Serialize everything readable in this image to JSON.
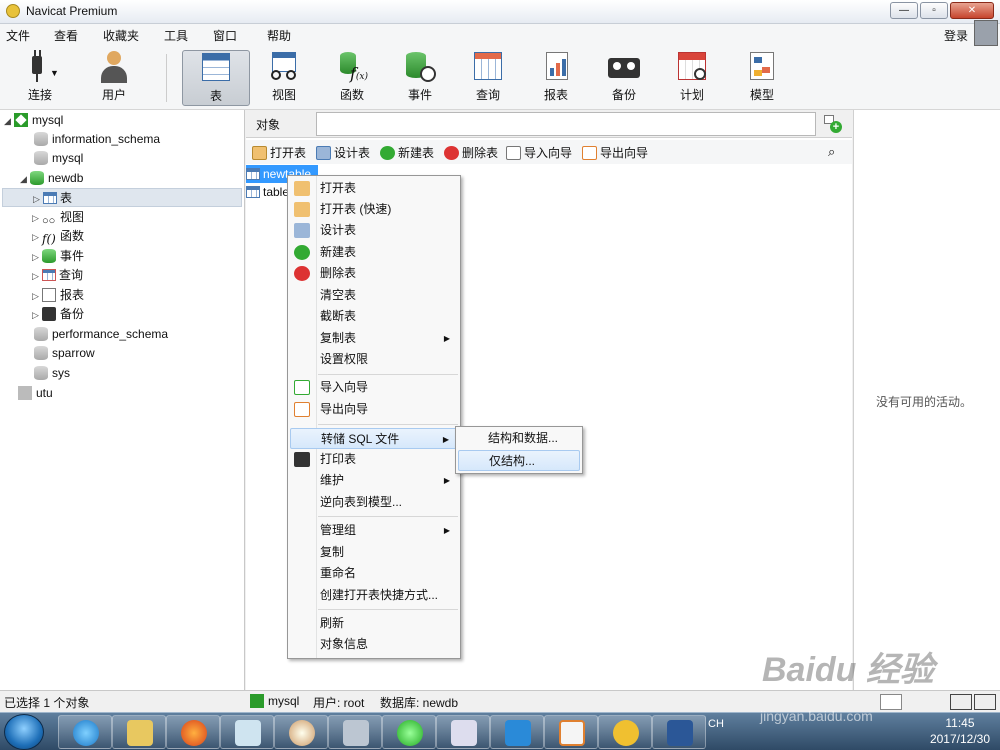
{
  "window": {
    "title": "Navicat Premium"
  },
  "menubar": {
    "items": [
      "文件",
      "查看",
      "收藏夹",
      "工具",
      "窗口",
      "帮助"
    ],
    "login": "登录"
  },
  "toolbar": {
    "items": [
      "连接",
      "用户",
      "表",
      "视图",
      "函数",
      "事件",
      "查询",
      "报表",
      "备份",
      "计划",
      "模型"
    ],
    "active": "表"
  },
  "tree": {
    "nodes": [
      {
        "label": "mysql"
      },
      {
        "label": "information_schema"
      },
      {
        "label": "mysql"
      },
      {
        "label": "newdb"
      },
      {
        "label": "表"
      },
      {
        "label": "视图"
      },
      {
        "label": "函数"
      },
      {
        "label": "事件"
      },
      {
        "label": "查询"
      },
      {
        "label": "报表"
      },
      {
        "label": "备份"
      },
      {
        "label": "performance_schema"
      },
      {
        "label": "sparrow"
      },
      {
        "label": "sys"
      },
      {
        "label": "utu"
      }
    ]
  },
  "objects": {
    "tab_label": "对象",
    "actions": [
      "打开表",
      "设计表",
      "新建表",
      "删除表",
      "导入向导",
      "导出向导"
    ],
    "items": [
      "newtable",
      "table"
    ]
  },
  "context_menu": {
    "items": [
      "打开表",
      "打开表 (快速)",
      "设计表",
      "新建表",
      "删除表",
      "清空表",
      "截断表",
      "复制表",
      "设置权限",
      "导入向导",
      "导出向导",
      "转储 SQL 文件",
      "打印表",
      "维护",
      "逆向表到模型...",
      "管理组",
      "复制",
      "重命名",
      "创建打开表快捷方式...",
      "刷新",
      "对象信息"
    ],
    "submenu": [
      "结构和数据...",
      "仅结构..."
    ]
  },
  "activity": {
    "empty": "没有可用的活动。"
  },
  "status": {
    "selected": "已选择 1 个对象",
    "conn": "mysql",
    "user": "用户: root",
    "db": "数据库: newdb"
  },
  "taskbar": {
    "lang": "CH",
    "time": "11:45",
    "date": "2017/12/30"
  },
  "watermark": {
    "logo": "Baidu 经验",
    "url": "jingyan.baidu.com"
  }
}
